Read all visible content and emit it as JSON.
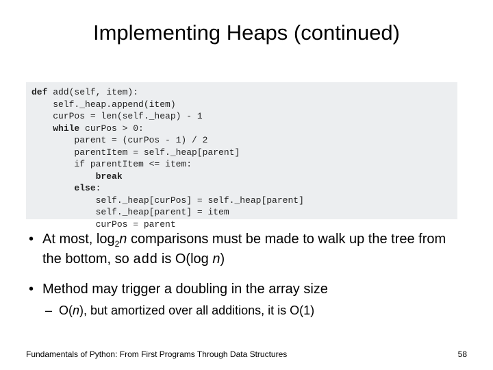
{
  "title": "Implementing Heaps (continued)",
  "code": {
    "l1a": "def",
    "l1b": " add(self, item):",
    "l2": "    self._heap.append(item)",
    "l3": "    curPos = len(self._heap) - 1",
    "l4a": "    ",
    "l4b": "while",
    "l4c": " curPos > 0:",
    "l5": "        parent = (curPos - 1) / 2",
    "l6": "        parentItem = self._heap[parent]",
    "l7": "        if parentItem <= item:",
    "l8a": "            ",
    "l8b": "break",
    "l9a": "        ",
    "l9b": "else",
    "l9c": ":",
    "l10": "            self._heap[curPos] = self._heap[parent]",
    "l11": "            self._heap[parent] = item",
    "l12": "            curPos = parent"
  },
  "bullets": {
    "b1_part1": "At most, log",
    "b1_sub": "2",
    "b1_part2": "n",
    "b1_part3": " comparisons must be made to walk up the tree from the bottom, so ",
    "b1_code": "add",
    "b1_part4": " is O(log ",
    "b1_part5": "n",
    "b1_part6": ")",
    "b2": "Method may trigger a doubling in the array size",
    "b2_sub_part1": "O(",
    "b2_sub_part2": "n",
    "b2_sub_part3": "), but amortized over all additions, it is O(1)"
  },
  "footer": {
    "text": "Fundamentals of Python: From First Programs Through Data Structures",
    "page": "58"
  }
}
